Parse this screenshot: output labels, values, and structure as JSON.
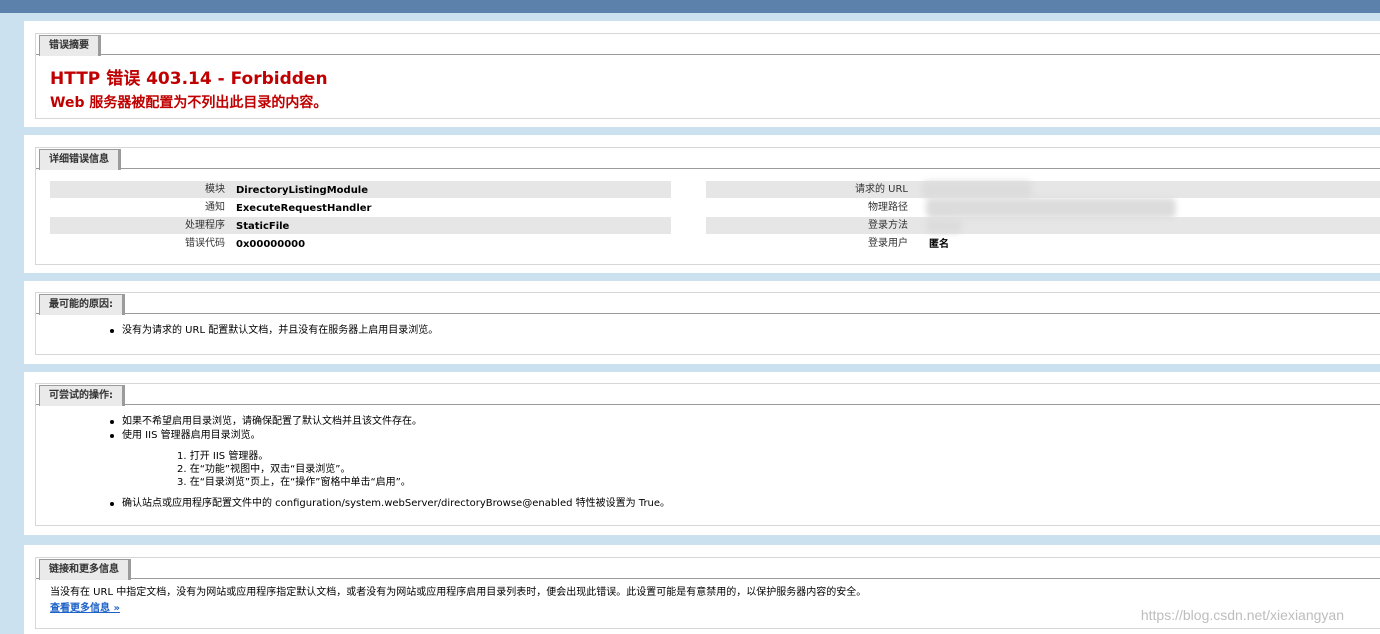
{
  "summary": {
    "tab": "错误摘要",
    "title": "HTTP 错误 403.14 - Forbidden",
    "subtitle": "Web 服务器被配置为不列出此目录的内容。"
  },
  "details": {
    "tab": "详细错误信息",
    "left": [
      {
        "label": "模块",
        "value": "DirectoryListingModule"
      },
      {
        "label": "通知",
        "value": "ExecuteRequestHandler"
      },
      {
        "label": "处理程序",
        "value": "StaticFile"
      },
      {
        "label": "错误代码",
        "value": "0x00000000"
      }
    ],
    "right": [
      {
        "label": "请求的 URL",
        "value": ""
      },
      {
        "label": "物理路径",
        "value": ""
      },
      {
        "label": "登录方法",
        "value": ""
      },
      {
        "label": "登录用户",
        "value": "匿名"
      }
    ]
  },
  "causes": {
    "tab": "最可能的原因:",
    "items": [
      "没有为请求的 URL 配置默认文档，并且没有在服务器上启用目录浏览。"
    ]
  },
  "actions": {
    "tab": "可尝试的操作:",
    "item1": "如果不希望启用目录浏览，请确保配置了默认文档并且该文件存在。",
    "item2": "使用 IIS 管理器启用目录浏览。",
    "steps": [
      "1.  打开 IIS 管理器。",
      "2.  在“功能”视图中，双击“目录浏览”。",
      "3.  在“目录浏览”页上，在“操作”窗格中单击“启用”。"
    ],
    "item3": "确认站点或应用程序配置文件中的 configuration/system.webServer/directoryBrowse@enabled 特性被设置为 True。"
  },
  "links": {
    "tab": "链接和更多信息",
    "text": "当没有在 URL 中指定文档，没有为网站或应用程序指定默认文档，或者没有为网站或应用程序启用目录列表时，便会出现此错误。此设置可能是有意禁用的，以保护服务器内容的安全。",
    "more": "查看更多信息 »"
  },
  "watermark": "https://blog.csdn.net/xiexiangyan"
}
